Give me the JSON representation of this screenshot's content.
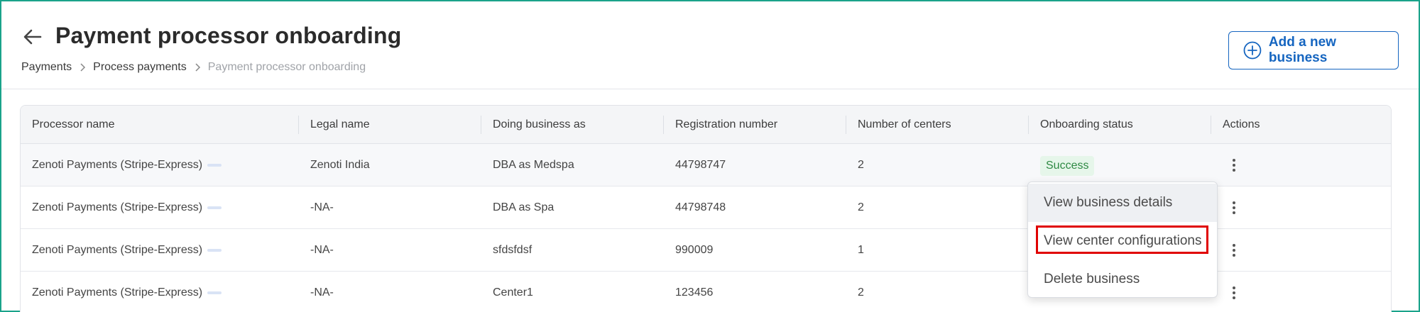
{
  "header": {
    "title": "Payment processor onboarding",
    "breadcrumb": [
      "Payments",
      "Process payments",
      "Payment processor onboarding"
    ],
    "add_button_label": "Add a new business"
  },
  "table": {
    "columns": [
      "Processor name",
      "Legal name",
      "Doing business as",
      "Registration number",
      "Number of centers",
      "Onboarding status",
      "Actions"
    ],
    "rows": [
      {
        "processor": "Zenoti Payments (Stripe-Express)",
        "legal": "Zenoti India",
        "dba": "DBA as Medspa",
        "registration": "44798747",
        "centers": "2",
        "status": "Success"
      },
      {
        "processor": "Zenoti Payments (Stripe-Express)",
        "legal": "-NA-",
        "dba": "DBA as Spa",
        "registration": "44798748",
        "centers": "2",
        "status": ""
      },
      {
        "processor": "Zenoti Payments (Stripe-Express)",
        "legal": "-NA-",
        "dba": "sfdsfdsf",
        "registration": "990009",
        "centers": "1",
        "status": ""
      },
      {
        "processor": "Zenoti Payments (Stripe-Express)",
        "legal": "-NA-",
        "dba": "Center1",
        "registration": "123456",
        "centers": "2",
        "status": ""
      }
    ]
  },
  "actions_menu": {
    "items": [
      "View business details",
      "View center configurations",
      "Delete business"
    ],
    "highlighted_index": 1
  },
  "colors": {
    "accent": "#1565c0",
    "frame": "#1aa38a",
    "success_bg": "#e6f6ea",
    "success_text": "#2f8a44",
    "highlight": "#e00000"
  },
  "icons": {
    "back": "arrow-left-icon",
    "add": "plus-circle-icon",
    "breadcrumb_separator": "chevron-right-icon",
    "actions": "kebab-menu-icon"
  }
}
